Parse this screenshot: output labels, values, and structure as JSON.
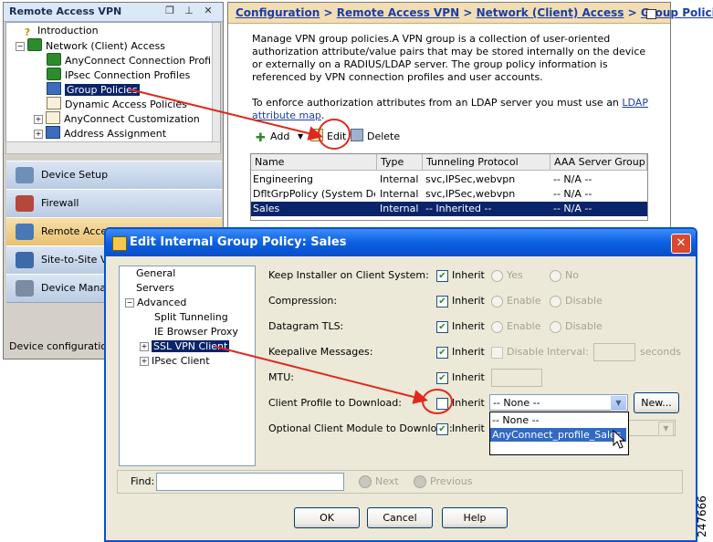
{
  "left_panel": {
    "title": "Remote Access VPN",
    "header_icons": [
      "window-restore-icon",
      "pin-icon",
      "close-icon"
    ],
    "tree": [
      {
        "label": "Introduction",
        "icon": "question-icon"
      },
      {
        "label": "Network (Client) Access",
        "icon": "network-icon",
        "expanded": true
      },
      {
        "label": "AnyConnect Connection Profiles",
        "icon": "network-icon"
      },
      {
        "label": "IPsec Connection Profiles",
        "icon": "network-icon"
      },
      {
        "label": "Group Policies",
        "icon": "group-icon",
        "selected": true
      },
      {
        "label": "Dynamic Access Policies",
        "icon": "document-icon"
      },
      {
        "label": "AnyConnect Customization",
        "icon": "document-icon"
      },
      {
        "label": "Address Assignment",
        "icon": "group-icon"
      }
    ],
    "nav_buttons": [
      {
        "label": "Device Setup",
        "icon": "device-setup-icon"
      },
      {
        "label": "Firewall",
        "icon": "firewall-icon"
      },
      {
        "label": "Remote Access VPN",
        "icon": "remote-access-icon",
        "active": true
      },
      {
        "label": "Site-to-Site VPN",
        "icon": "site-to-site-icon"
      },
      {
        "label": "Device Management",
        "icon": "device-management-icon"
      }
    ],
    "status": "Device configuration lo"
  },
  "right_panel": {
    "breadcrumb": [
      "Configuration",
      "Remote Access VPN",
      "Network (Client) Access",
      "Group Policies"
    ],
    "breadcrumb_sep": ">",
    "description": "Manage VPN group policies.A VPN group is a collection of user-oriented authorization attribute/value pairs that may be stored internally on the device or externally on a RADIUS/LDAP server. The group policy information is referenced by VPN connection profiles and user accounts.",
    "ldap_text": "To enforce authorization attributes from an LDAP server you must use an",
    "ldap_link": "LDAP attribute map",
    "toolbar": {
      "add": "Add",
      "edit": "Edit",
      "delete": "Delete"
    },
    "table": {
      "columns": [
        "Name",
        "Type",
        "Tunneling Protocol",
        "AAA Server Group"
      ],
      "rows": [
        [
          "Engineering",
          "Internal",
          "svc,IPSec,webvpn",
          "-- N/A --"
        ],
        [
          "DfltGrpPolicy (System De...",
          "Internal",
          "svc,IPSec,webvpn",
          "-- N/A --"
        ],
        [
          "Sales",
          "Internal",
          "-- Inherited --",
          "-- N/A --"
        ]
      ],
      "selected_row": 2
    }
  },
  "dialog": {
    "title": "Edit Internal Group Policy: Sales",
    "tree": [
      {
        "label": "General"
      },
      {
        "label": "Servers"
      },
      {
        "label": "Advanced",
        "expanded": true
      },
      {
        "label": "Split Tunneling"
      },
      {
        "label": "IE Browser Proxy"
      },
      {
        "label": "SSL VPN Client",
        "selected": true
      },
      {
        "label": "IPsec Client"
      }
    ],
    "fields": {
      "keep_installer": {
        "label": "Keep Installer on Client System:",
        "inherit": "Inherit",
        "opt1": "Yes",
        "opt2": "No"
      },
      "compression": {
        "label": "Compression:",
        "inherit": "Inherit",
        "opt1": "Enable",
        "opt2": "Disable"
      },
      "datagram_tls": {
        "label": "Datagram TLS:",
        "inherit": "Inherit",
        "opt1": "Enable",
        "opt2": "Disable"
      },
      "keepalive": {
        "label": "Keepalive Messages:",
        "inherit": "Inherit",
        "disable": "Disable",
        "interval": "Interval:",
        "unit": "seconds"
      },
      "mtu": {
        "label": "MTU:",
        "inherit": "Inherit"
      },
      "client_profile": {
        "label": "Client Profile to Download:",
        "inherit": "Inherit",
        "value": "-- None --",
        "new_button": "New..."
      },
      "optional_module": {
        "label": "Optional Client Module to Download:",
        "inherit": "Inherit"
      }
    },
    "dropdown_options": [
      "-- None --",
      "AnyConnect_profile_Sales"
    ],
    "dropdown_highlight": 1,
    "find": {
      "label": "Find:",
      "next": "Next",
      "previous": "Previous"
    },
    "buttons": {
      "ok": "OK",
      "cancel": "Cancel",
      "help": "Help"
    }
  },
  "figure_id": "247666",
  "colors": {
    "annotation_red": "#e0281f",
    "selection": "#0a246a",
    "dialog_title": "#0b5fe3",
    "breadcrumb_bg": "#f3ddb3"
  }
}
